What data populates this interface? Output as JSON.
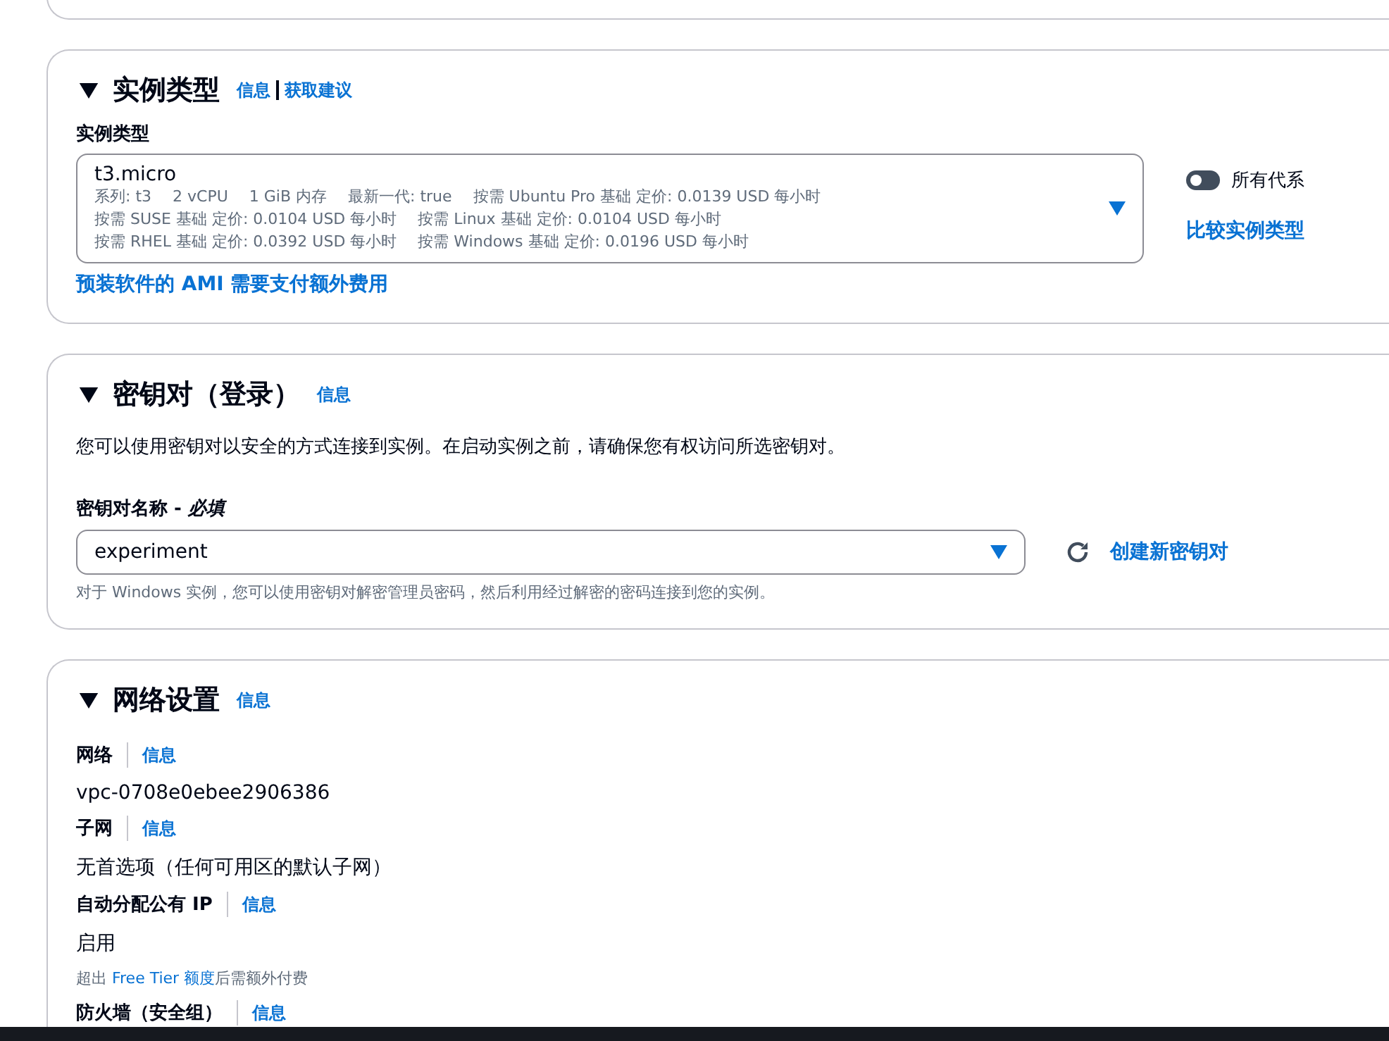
{
  "instance_type": {
    "title": "实例类型",
    "info_links": [
      "信息",
      "获取建议"
    ],
    "label": "实例类型",
    "select": {
      "value": "t3.micro",
      "detail_lines": [
        [
          "系列: t3",
          "2 vCPU",
          "1 GiB 内存",
          "最新一代: true",
          "按需 Ubuntu Pro 基础 定价: 0.0139 USD 每小时"
        ],
        [
          "按需 SUSE 基础 定价: 0.0104 USD 每小时",
          "按需 Linux 基础 定价: 0.0104 USD 每小时"
        ],
        [
          "按需 RHEL 基础 定价: 0.0392 USD 每小时",
          "按需 Windows 基础 定价: 0.0196 USD 每小时"
        ]
      ]
    },
    "toggle": {
      "label": "所有代系",
      "on": false
    },
    "compare_link": "比较实例类型",
    "ami_link": "预装软件的 AMI 需要支付额外费用"
  },
  "key_pair": {
    "title": "密钥对（登录）",
    "info": "信息",
    "description": "您可以使用密钥对以安全的方式连接到实例。在启动实例之前，请确保您有权访问所选密钥对。",
    "label": "密钥对名称 - *必填*",
    "select": {
      "value": "experiment"
    },
    "create_link": "创建新密钥对",
    "hint": "对于 Windows 实例，您可以使用密钥对解密管理员密码，然后利用经过解密的密码连接到您的实例。"
  },
  "network": {
    "title": "网络设置",
    "info": "信息",
    "fields": [
      {
        "label": "网络",
        "info": "信息",
        "value": "vpc-0708e0ebee2906386"
      },
      {
        "label": "子网",
        "info": "信息",
        "value": "无首选项（任何可用区的默认子网）"
      },
      {
        "label": "自动分配公有 IP",
        "info": "信息",
        "value": "启用",
        "hint": [
          {
            "kind": "text",
            "text": "超出 "
          },
          {
            "kind": "link",
            "text": "Free Tier 额度"
          },
          {
            "kind": "text",
            "text": "后需额外付费"
          }
        ]
      },
      {
        "label": "防火墙（安全组）",
        "info": "信息"
      }
    ]
  }
}
